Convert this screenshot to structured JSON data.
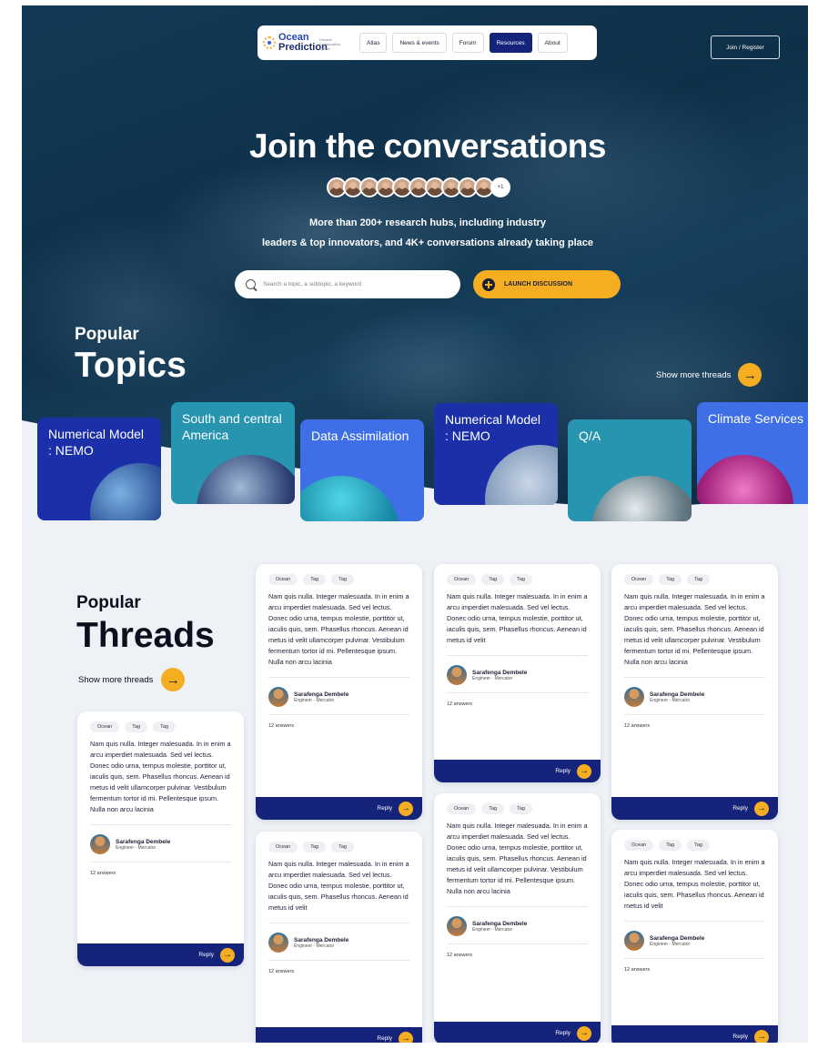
{
  "nav": {
    "logo_line1": "Ocean",
    "logo_line2": "Prediction",
    "logo_tagline": "Decade Collaborative Centre",
    "items": [
      "Atlas",
      "News & events",
      "Forum",
      "Resources",
      "About"
    ],
    "active_index": 3,
    "join_label": "Join / Register"
  },
  "hero": {
    "title": "Join the conversations",
    "avatar_more": "+1",
    "subtitle_line1": "More than 200+ research hubs, including industry",
    "subtitle_line2": "leaders & top innovators, and 4K+ conversations already taking place",
    "search_placeholder": "Search a topic, a subtopic, a keyword",
    "launch_label": "LAUNCH DISCUSSION"
  },
  "topics": {
    "heading_small": "Popular",
    "heading_big": "Topics",
    "show_more": "Show more threads",
    "cards": [
      {
        "label": "Numerical Model : NEMO",
        "color": "#1a2fa8"
      },
      {
        "label": "South and central America",
        "color": "#2794b0"
      },
      {
        "label": "Data Assimilation",
        "color": "#3f6fe6"
      },
      {
        "label": "Numerical Model : NEMO",
        "color": "#1a2fa8"
      },
      {
        "label": "Q/A",
        "color": "#2794b0"
      },
      {
        "label": "Climate Services",
        "color": "#3f6fe6"
      }
    ]
  },
  "threads": {
    "heading_small": "Popular",
    "heading_big": "Threads",
    "show_more": "Show more threads",
    "tags": [
      "Ocean",
      "Tag",
      "Tag"
    ],
    "body_long": "Nam quis nulla. Integer malesuada. In in enim a arcu imperdiet malesuada. Sed vel lectus. Donec odio urna, tempus molestie, porttitor ut, iaculis quis, sem. Phasellus rhoncus. Aenean id metus id velit ullamcorper pulvinar. Vestibulum fermentum tortor id mi. Pellentesque ipsum. Nulla non arcu lacinia",
    "body_short": "Nam quis nulla. Integer malesuada. In in enim a arcu imperdiet malesuada. Sed vel lectus. Donec odio urna, tempus molestie, porttitor ut, iaculis quis, sem. Phasellus rhoncus. Aenean id metus id velit",
    "author_name": "Sarafenga Dembele",
    "author_role": "Engineer - Mercator",
    "answers": "12 answers",
    "reply": "Reply"
  },
  "colors": {
    "accent": "#f5ad21",
    "navy": "#16237a",
    "page_bg": "#eef1f6"
  }
}
